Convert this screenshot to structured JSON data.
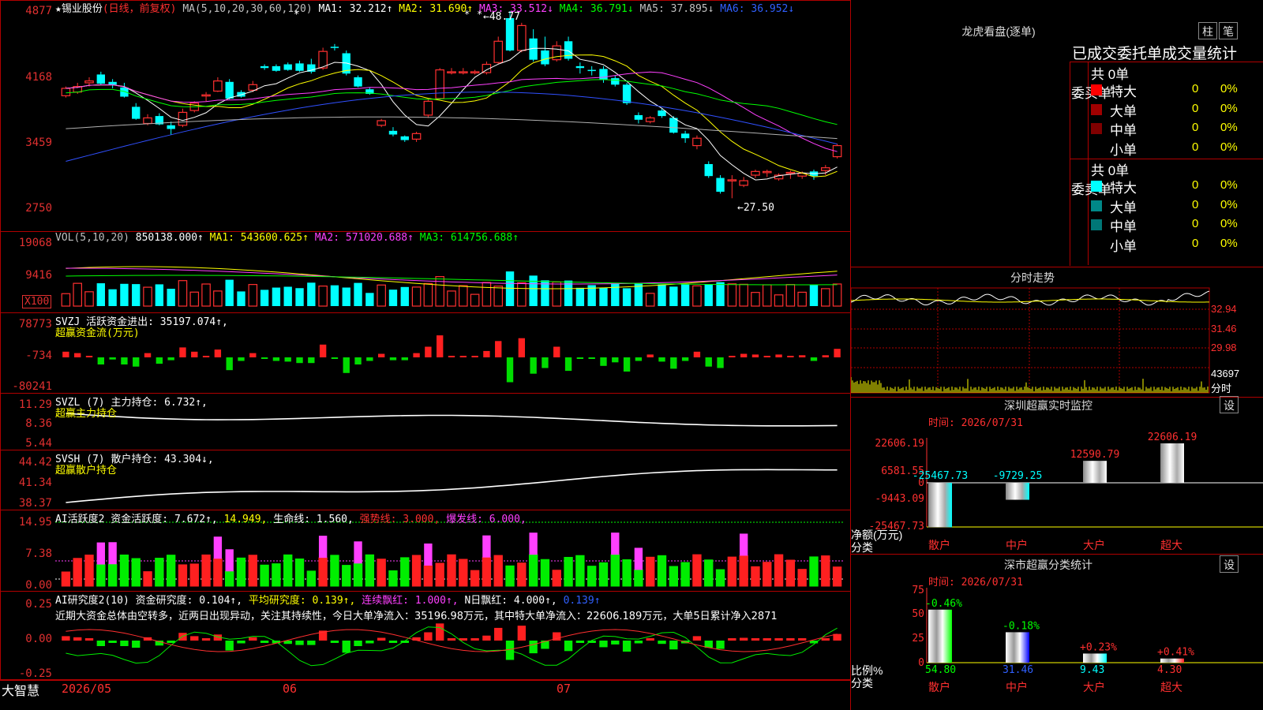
{
  "stock": {
    "name": "★锡业股份",
    "mode": "(日线，前复权)"
  },
  "ma_header": {
    "prefix": "MA(5,10,20,30,60,120)",
    "ma1": "MA1: 32.212↑",
    "ma2": "MA2: 31.690↑",
    "ma3": "MA3: 33.512↓",
    "ma4": "MA4: 36.791↓",
    "ma5": "MA5: 37.895↓",
    "ma6": "MA6: 36.952↓"
  },
  "price_axis": [
    "4877",
    "4168",
    "3459",
    "2750"
  ],
  "price_marks": {
    "high": "←48.77",
    "low": "←27.50"
  },
  "vol": {
    "title": "VOL(5,10,20)",
    "value": "850138.000↑",
    "ma1": "MA1: 543600.625↑",
    "ma2": "MA2: 571020.688↑",
    "ma3": "MA3: 614756.688↑",
    "axis": [
      "19068",
      "9416"
    ],
    "unit": "X100"
  },
  "svzj": {
    "title": "SVZJ  活跃资金进出: 35197.074↑,",
    "sub": "超赢资金流(万元)",
    "axis": [
      "78773",
      "-734",
      "-80241"
    ]
  },
  "svzl": {
    "title": "SVZL (7) 主力持仓: 6.732↑,",
    "sub": "超赢主力持仓",
    "axis": [
      "11.29",
      "8.36",
      "5.44"
    ]
  },
  "svsh": {
    "title": "SVSH (7) 散户持仓: 43.304↓,",
    "sub": "超赢散户持仓",
    "axis": [
      "44.42",
      "41.34",
      "38.37"
    ]
  },
  "ai1": {
    "title": "AI活跃度2 资金活跃度: 7.672↑,",
    "v2": "14.949,",
    "life": "生命线: 1.560,",
    "strong": "强势线: 3.000,",
    "burst": "爆发线: 6.000,",
    "axis": [
      "14.95",
      "7.38",
      "0.00"
    ]
  },
  "ai2": {
    "title": "AI研究度2(10) 资金研究度: 0.104↑,",
    "avg": "平均研究度: 0.139↑,",
    "red": "连续飘红: 1.000↑,",
    "nred": "N日飘红: 4.000↑,",
    "last": "0.139↑",
    "axis": [
      "0.25",
      "0.00",
      "-0.25"
    ],
    "note": "近期大资金总体由空转多，近两日出现异动，关注其持续性，今日大单净流入：35196.98万元，其中特大单净流入：22606.189万元，大单5日累计净入2871"
  },
  "dates": {
    "brand": "大智慧",
    "d1": "2026/05",
    "d2": "06",
    "d3": "07"
  },
  "lhb": {
    "title": "龙虎看盘(逐单)",
    "btn1": "柱",
    "btn2": "笔",
    "sub": "已成交委托单成交量统计",
    "buy_label": "委买单",
    "sell_label": "委卖单",
    "buy_total": "共 0单",
    "sell_total": "共 0单",
    "buy_rows": [
      {
        "name": "特大",
        "v": "0",
        "p": "0%",
        "c": "#ff0000"
      },
      {
        "name": "大单",
        "v": "0",
        "p": "0%",
        "c": "#a00000"
      },
      {
        "name": "中单",
        "v": "0",
        "p": "0%",
        "c": "#800000"
      },
      {
        "name": "小单",
        "v": "0",
        "p": "0%",
        "c": ""
      }
    ],
    "sell_rows": [
      {
        "name": "特大",
        "v": "0",
        "p": "0%",
        "c": "#00ffff"
      },
      {
        "name": "大单",
        "v": "0",
        "p": "0%",
        "c": "#008888"
      },
      {
        "name": "中单",
        "v": "0",
        "p": "0%",
        "c": "#007777"
      },
      {
        "name": "小单",
        "v": "0",
        "p": "0%",
        "c": ""
      }
    ]
  },
  "fenshi": {
    "title": "分时走势",
    "axis": [
      "32.94",
      "31.46",
      "29.98",
      "43697",
      "分时"
    ]
  },
  "monitor": {
    "title": "深圳超赢实时监控",
    "btn": "设",
    "time": "时间: 2026/07/31",
    "axis": [
      "22606.19",
      "6581.55",
      "0",
      "-9443.09",
      "-25467.73"
    ],
    "ylabel": "净额(万元)",
    "xlabel": "分类",
    "bars": [
      {
        "cat": "散户",
        "val": "-25467.73"
      },
      {
        "cat": "中户",
        "val": "-9729.25"
      },
      {
        "cat": "大户",
        "val": "12590.79"
      },
      {
        "cat": "超大",
        "val": "22606.19"
      }
    ]
  },
  "stat": {
    "title": "深市超赢分类统计",
    "btn": "设",
    "time": "时间: 2026/07/31",
    "axis": [
      "75",
      "50",
      "25",
      "0"
    ],
    "ylabel": "比例%",
    "xlabel": "分类",
    "bars": [
      {
        "cat": "散户",
        "top": "-0.46%",
        "bot": "54.80"
      },
      {
        "cat": "中户",
        "top": "-0.18%",
        "bot": "31.46"
      },
      {
        "cat": "大户",
        "top": "+0.23%",
        "bot": "9.43"
      },
      {
        "cat": "超大",
        "top": "+0.41%",
        "bot": "4.30"
      }
    ]
  },
  "chart_data": {
    "type": "bar",
    "candles": [
      [
        3.96,
        4.04,
        3.94,
        4.06,
        3.92
      ],
      [
        4.0,
        4.06,
        3.98,
        4.1,
        3.96
      ],
      [
        4.1,
        4.12,
        4.06,
        4.16,
        4.04
      ],
      [
        4.19,
        4.09,
        4.08,
        4.22,
        4.06
      ],
      [
        4.11,
        4.08,
        4.04,
        4.14,
        4.02
      ],
      [
        4.05,
        3.95,
        3.94,
        4.1,
        3.92
      ],
      [
        3.84,
        3.71,
        3.7,
        3.88,
        3.68
      ],
      [
        3.66,
        3.72,
        3.64,
        3.76,
        3.6
      ],
      [
        3.74,
        3.65,
        3.64,
        3.77,
        3.62
      ],
      [
        3.64,
        3.6,
        3.54,
        3.68,
        3.5
      ],
      [
        3.64,
        3.78,
        3.62,
        3.82,
        3.6
      ],
      [
        3.8,
        3.88,
        3.78,
        3.9,
        3.76
      ],
      [
        3.96,
        3.97,
        3.9,
        4.0,
        3.88
      ],
      [
        4.01,
        4.12,
        4.0,
        4.16,
        3.98
      ],
      [
        4.11,
        3.93,
        3.92,
        4.14,
        3.9
      ],
      [
        4.0,
        3.95,
        3.94,
        4.02,
        3.92
      ],
      [
        4.02,
        4.08,
        4.0,
        4.12,
        3.98
      ],
      [
        4.28,
        4.26,
        4.24,
        4.3,
        4.22
      ],
      [
        4.28,
        4.23,
        4.22,
        4.3,
        4.18
      ],
      [
        4.3,
        4.24,
        4.23,
        4.32,
        4.2
      ],
      [
        4.31,
        4.23,
        4.22,
        4.34,
        4.2
      ],
      [
        4.3,
        4.22,
        4.2,
        4.36,
        4.18
      ],
      [
        4.26,
        4.44,
        4.24,
        4.48,
        4.22
      ],
      [
        4.49,
        4.48,
        4.45,
        4.52,
        4.42
      ],
      [
        4.42,
        4.2,
        4.18,
        4.45,
        4.16
      ],
      [
        4.16,
        4.06,
        4.05,
        4.18,
        4.03
      ],
      [
        4.03,
        3.98,
        3.97,
        4.05,
        3.93
      ],
      [
        3.64,
        3.69,
        3.62,
        3.71,
        3.6
      ],
      [
        3.58,
        3.54,
        3.52,
        3.62,
        3.5
      ],
      [
        3.52,
        3.48,
        3.46,
        3.53,
        3.42
      ],
      [
        3.49,
        3.55,
        3.46,
        3.57,
        3.44
      ],
      [
        3.75,
        3.9,
        3.72,
        3.93,
        3.7
      ],
      [
        3.93,
        4.24,
        3.92,
        4.26,
        3.9
      ],
      [
        4.21,
        4.22,
        4.19,
        4.26,
        4.17
      ],
      [
        4.21,
        4.22,
        4.19,
        4.26,
        4.17
      ],
      [
        4.21,
        4.22,
        4.19,
        4.24,
        4.17
      ],
      [
        4.21,
        4.3,
        4.19,
        4.33,
        4.17
      ],
      [
        4.32,
        4.55,
        4.3,
        4.6,
        4.28
      ],
      [
        4.8,
        4.45,
        4.44,
        4.877,
        4.4
      ],
      [
        4.45,
        4.72,
        4.43,
        4.75,
        4.4
      ],
      [
        4.58,
        4.35,
        4.33,
        4.68,
        4.3
      ],
      [
        4.45,
        4.3,
        4.28,
        4.6,
        4.26
      ],
      [
        4.35,
        4.5,
        4.33,
        4.55,
        4.3
      ],
      [
        4.55,
        4.36,
        4.34,
        4.6,
        4.32
      ],
      [
        4.28,
        4.26,
        4.2,
        4.32,
        4.15
      ],
      [
        4.24,
        4.23,
        4.18,
        4.28,
        4.16
      ],
      [
        4.25,
        4.13,
        4.1,
        4.28,
        4.08
      ],
      [
        4.15,
        4.08,
        4.06,
        4.18,
        4.04
      ],
      [
        4.08,
        3.88,
        3.86,
        4.1,
        3.84
      ],
      [
        3.75,
        3.7,
        3.66,
        3.78,
        3.62
      ],
      [
        3.68,
        3.72,
        3.66,
        3.74,
        3.64
      ],
      [
        3.8,
        3.74,
        3.72,
        3.82,
        3.7
      ],
      [
        3.72,
        3.56,
        3.55,
        3.74,
        3.53
      ],
      [
        3.55,
        3.5,
        3.45,
        3.58,
        3.42
      ],
      [
        3.42,
        3.5,
        3.38,
        3.53,
        3.36
      ],
      [
        3.22,
        3.09,
        3.07,
        3.25,
        3.03
      ],
      [
        3.07,
        2.92,
        2.9,
        3.1,
        2.88
      ],
      [
        3.05,
        3.05,
        2.85,
        3.1,
        2.75
      ],
      [
        2.99,
        3.04,
        2.97,
        3.08,
        2.95
      ],
      [
        3.1,
        3.14,
        3.07,
        3.16,
        3.05
      ],
      [
        3.13,
        3.14,
        3.08,
        3.16,
        3.05
      ],
      [
        3.06,
        3.1,
        3.04,
        3.12,
        3.02
      ],
      [
        3.12,
        3.13,
        3.06,
        3.15,
        3.04
      ],
      [
        3.09,
        3.12,
        3.06,
        3.14,
        3.03
      ],
      [
        3.14,
        3.09,
        3.05,
        3.16,
        3.03
      ],
      [
        3.15,
        3.18,
        3.1,
        3.21,
        3.06
      ],
      [
        3.3,
        3.42,
        3.28,
        3.44,
        3.26
      ]
    ]
  }
}
